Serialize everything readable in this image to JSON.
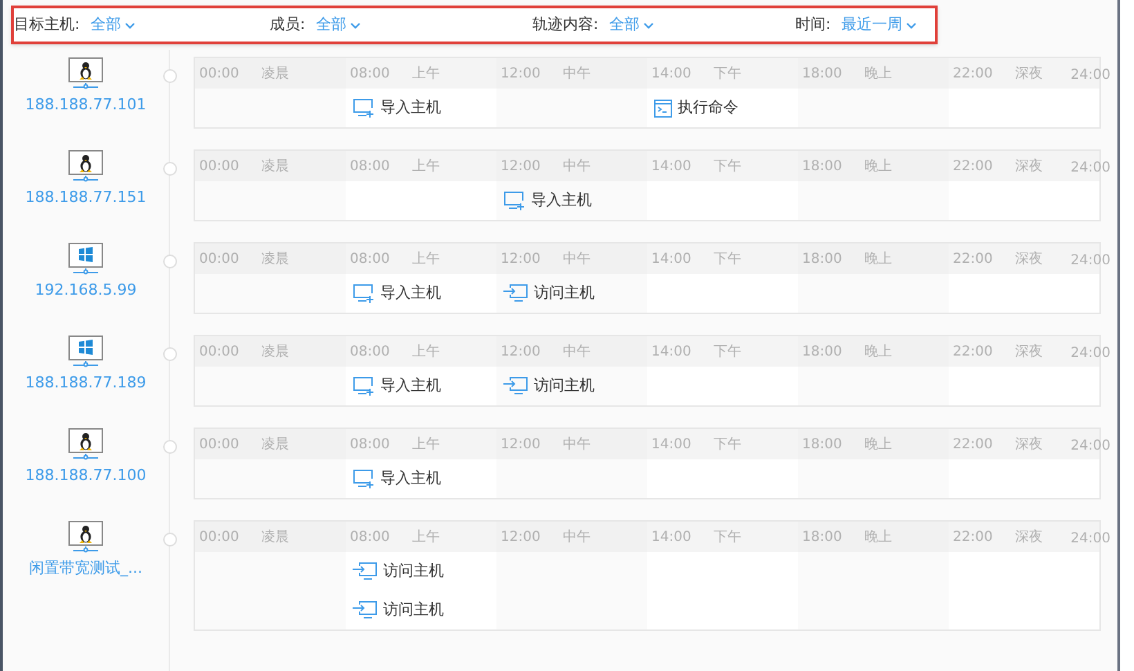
{
  "filters": [
    {
      "label": "目标主机:",
      "value": "全部"
    },
    {
      "label": "成员:",
      "value": "全部"
    },
    {
      "label": "轨迹内容:",
      "value": "全部"
    },
    {
      "label": "时间:",
      "value": "最近一周"
    }
  ],
  "hosts": [
    {
      "kind": "linux",
      "name": "188.188.77.101",
      "end_time": "24:00",
      "segments": [
        {
          "time": "00:00",
          "period": "凌晨"
        },
        {
          "time": "08:00",
          "period": "上午",
          "events": [
            {
              "kind": "import",
              "label": "导入主机"
            }
          ]
        },
        {
          "time": "12:00",
          "period": "中午"
        },
        {
          "time": "14:00",
          "period": "下午",
          "events": [
            {
              "kind": "command",
              "label": "执行命令"
            }
          ]
        },
        {
          "time": "18:00",
          "period": "晚上"
        },
        {
          "time": "22:00",
          "period": "深夜"
        }
      ]
    },
    {
      "kind": "linux",
      "name": "188.188.77.151",
      "end_time": "24:00",
      "segments": [
        {
          "time": "00:00",
          "period": "凌晨"
        },
        {
          "time": "08:00",
          "period": "上午"
        },
        {
          "time": "12:00",
          "period": "中午",
          "events": [
            {
              "kind": "import",
              "label": "导入主机"
            }
          ]
        },
        {
          "time": "14:00",
          "period": "下午"
        },
        {
          "time": "18:00",
          "period": "晚上"
        },
        {
          "time": "22:00",
          "period": "深夜"
        }
      ]
    },
    {
      "kind": "windows",
      "name": "192.168.5.99",
      "end_time": "24:00",
      "segments": [
        {
          "time": "00:00",
          "period": "凌晨"
        },
        {
          "time": "08:00",
          "period": "上午",
          "events": [
            {
              "kind": "import",
              "label": "导入主机"
            }
          ]
        },
        {
          "time": "12:00",
          "period": "中午",
          "events": [
            {
              "kind": "visit",
              "label": "访问主机"
            }
          ]
        },
        {
          "time": "14:00",
          "period": "下午"
        },
        {
          "time": "18:00",
          "period": "晚上"
        },
        {
          "time": "22:00",
          "period": "深夜"
        }
      ]
    },
    {
      "kind": "windows",
      "name": "188.188.77.189",
      "end_time": "24:00",
      "segments": [
        {
          "time": "00:00",
          "period": "凌晨"
        },
        {
          "time": "08:00",
          "period": "上午",
          "events": [
            {
              "kind": "import",
              "label": "导入主机"
            }
          ]
        },
        {
          "time": "12:00",
          "period": "中午",
          "events": [
            {
              "kind": "visit",
              "label": "访问主机"
            }
          ]
        },
        {
          "time": "14:00",
          "period": "下午"
        },
        {
          "time": "18:00",
          "period": "晚上"
        },
        {
          "time": "22:00",
          "period": "深夜"
        }
      ]
    },
    {
      "kind": "linux",
      "name": "188.188.77.100",
      "end_time": "24:00",
      "segments": [
        {
          "time": "00:00",
          "period": "凌晨"
        },
        {
          "time": "08:00",
          "period": "上午",
          "events": [
            {
              "kind": "import",
              "label": "导入主机"
            }
          ]
        },
        {
          "time": "12:00",
          "period": "中午"
        },
        {
          "time": "14:00",
          "period": "下午"
        },
        {
          "time": "18:00",
          "period": "晚上"
        },
        {
          "time": "22:00",
          "period": "深夜"
        }
      ]
    },
    {
      "kind": "linux",
      "name": "闲置带宽测试_...",
      "end_time": "24:00",
      "segments": [
        {
          "time": "00:00",
          "period": "凌晨"
        },
        {
          "time": "08:00",
          "period": "上午",
          "events": [
            {
              "kind": "visit",
              "label": "访问主机"
            },
            {
              "kind": "visit",
              "label": "访问主机"
            }
          ]
        },
        {
          "time": "12:00",
          "period": "中午"
        },
        {
          "time": "14:00",
          "period": "下午"
        },
        {
          "time": "18:00",
          "period": "晚上"
        },
        {
          "time": "22:00",
          "period": "深夜"
        }
      ]
    }
  ]
}
